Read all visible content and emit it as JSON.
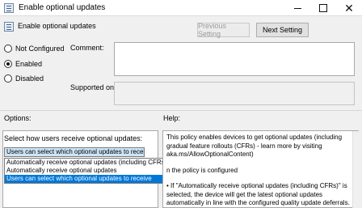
{
  "window": {
    "title": "Enable optional updates",
    "controls": {
      "minimize": "minimize",
      "maximize": "maximize",
      "close": "✕"
    }
  },
  "header": {
    "policy_title": "Enable optional updates",
    "previous_button": "Previous Setting",
    "next_button": "Next Setting"
  },
  "state": {
    "options": [
      {
        "label": "Not Configured",
        "checked": false
      },
      {
        "label": "Enabled",
        "checked": true
      },
      {
        "label": "Disabled",
        "checked": false
      }
    ]
  },
  "fields": {
    "comment_label": "Comment:",
    "comment_value": "",
    "supported_label": "Supported on:",
    "supported_value": ""
  },
  "options_section": {
    "label": "Options:",
    "caption": "Select how users receive optional updates:",
    "selected_value": "Users can select which optional updates to receive",
    "dropdown_items": [
      "Automatically receive optional updates (including CFRs)",
      "Automatically receive optional updates",
      "Users can select which optional updates to receive"
    ],
    "highlighted_index": 2
  },
  "help_section": {
    "label": "Help:",
    "paragraphs": [
      "This policy enables devices to get optional updates (including gradual feature rollouts (CFRs) - learn more by visiting aka.ms/AllowOptionalContent)",
      "n the policy is configured",
      "• If \"Automatically receive optional updates (including CFRs)\" is selected, the device will get the latest optional updates automatically in line with the configured quality update deferrals."
    ]
  },
  "colors": {
    "selection": "#0078d7",
    "dropdown_focus": "#cce4f7",
    "disabled_text": "#9b9b9b"
  }
}
